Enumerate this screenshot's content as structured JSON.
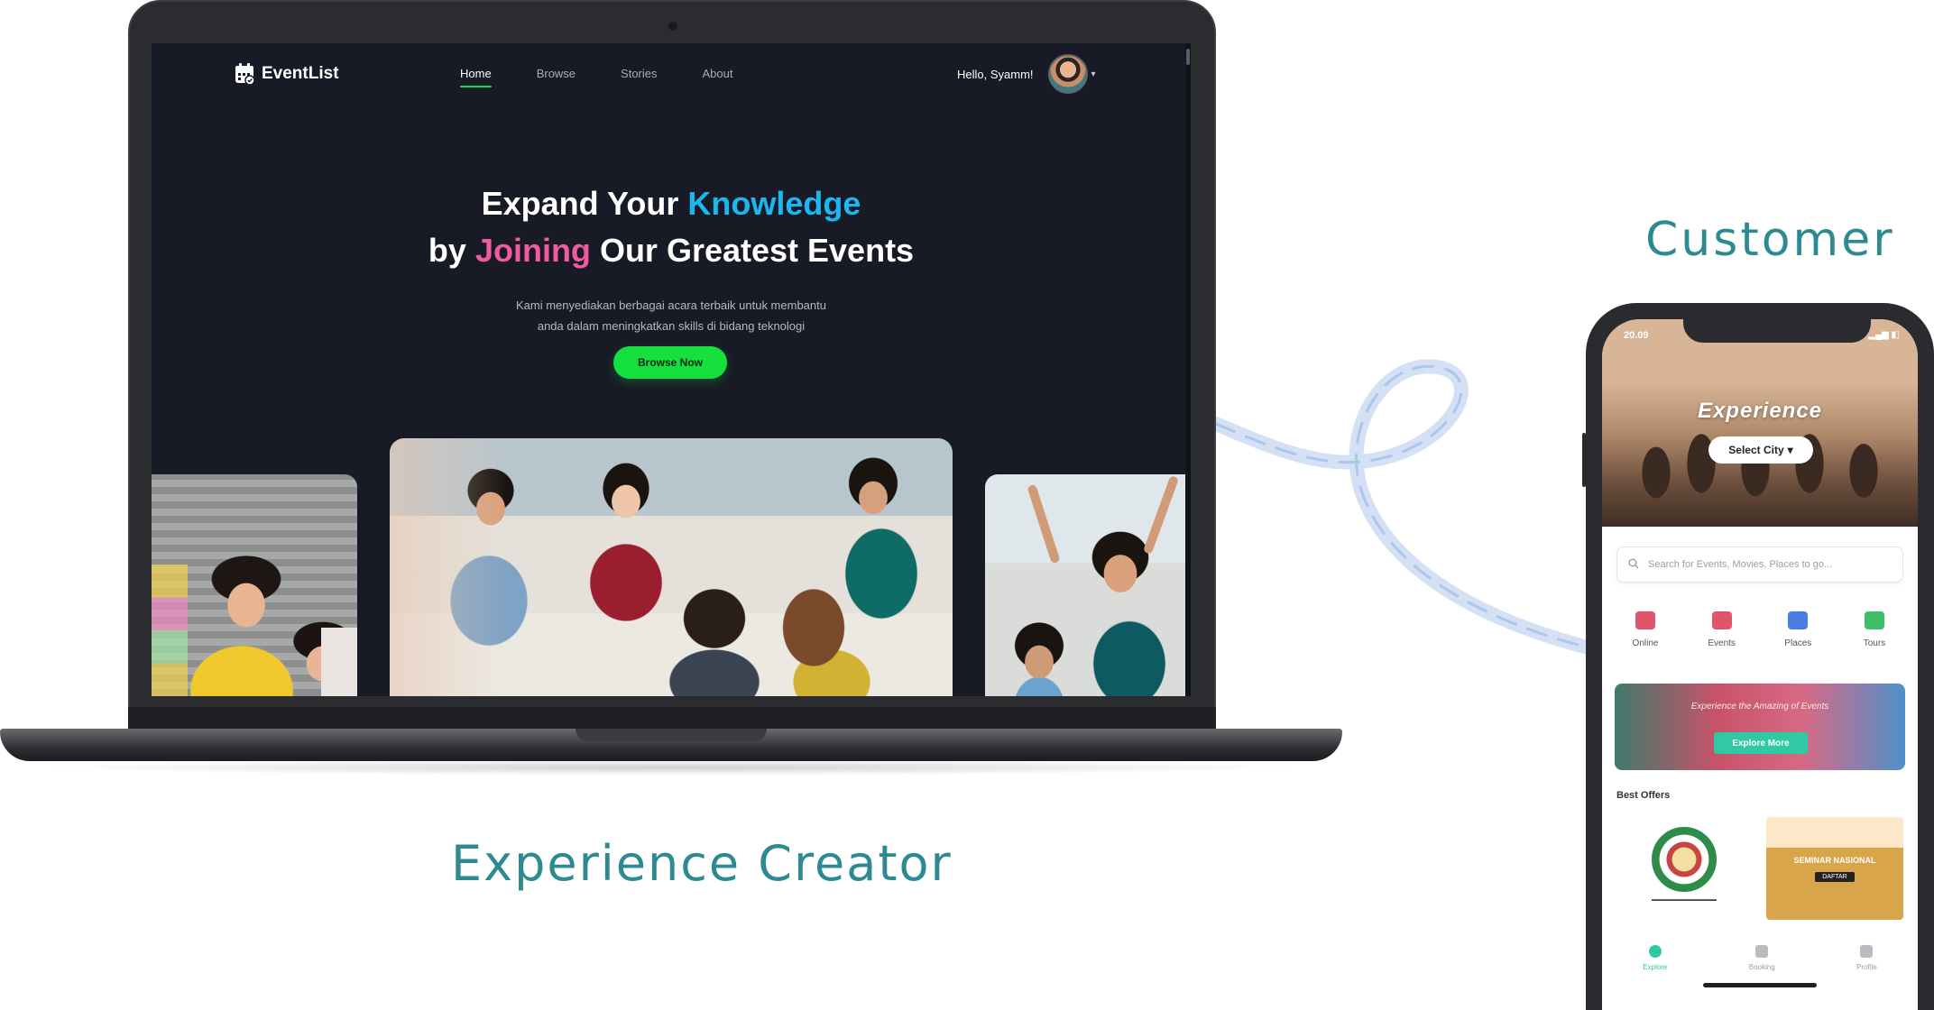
{
  "laptop": {
    "brand": "EventList",
    "nav": [
      {
        "label": "Home",
        "active": true
      },
      {
        "label": "Browse",
        "active": false
      },
      {
        "label": "Stories",
        "active": false
      },
      {
        "label": "About",
        "active": false
      }
    ],
    "greeting": "Hello, Syamm!",
    "hero": {
      "line1_a": "Expand Your ",
      "line1_b": "Knowledge",
      "line2_a": "by ",
      "line2_b": "Joining",
      "line2_c": " Our Greatest Events",
      "subtitle_line1": "Kami menyediakan berbagai acara terbaik untuk membantu",
      "subtitle_line2": "anda dalam meningkatkan skills di bidang teknologi",
      "cta": "Browse Now"
    },
    "colors": {
      "accent_green": "#16e03e",
      "highlight_blue": "#1ab7f0",
      "highlight_pink": "#f05aa3",
      "background": "#181b25"
    }
  },
  "labels": {
    "creator": "Experience Creator",
    "customer": "Customer"
  },
  "phone": {
    "time": "20.09",
    "hero_title": "Experience",
    "city_button": "Select City",
    "search_placeholder": "Search for Events, Movies, Places to go...",
    "categories": [
      {
        "label": "Online",
        "color": "#e0556b"
      },
      {
        "label": "Events",
        "color": "#e0556b"
      },
      {
        "label": "Places",
        "color": "#4a7de0"
      },
      {
        "label": "Tours",
        "color": "#3fbf6a"
      }
    ],
    "banner": {
      "text": "Experience the Amazing of Events",
      "button": "Explore More"
    },
    "best_offers": "Best Offers",
    "offer2": {
      "title": "SEMINAR NASIONAL",
      "button": "DAFTAR"
    },
    "tabs": [
      {
        "label": "Explore",
        "active": true
      },
      {
        "label": "Booking",
        "active": false
      },
      {
        "label": "Profile",
        "active": false
      }
    ]
  }
}
